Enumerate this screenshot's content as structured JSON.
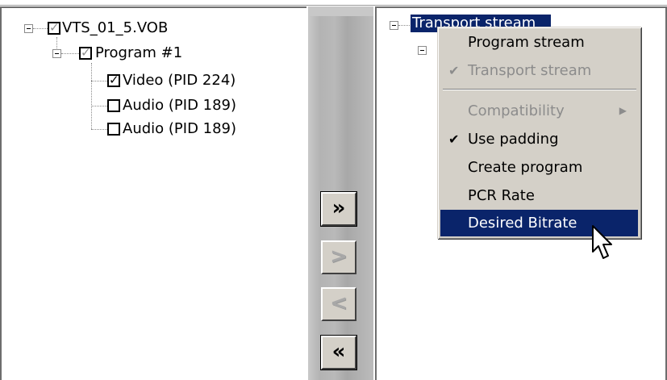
{
  "left_tree": {
    "root_label": "VTS_01_5.VOB",
    "program_label": "Program #1",
    "streams": [
      {
        "label": "Video (PID 224)",
        "checked": true
      },
      {
        "label": "Audio (PID 189)",
        "checked": false
      },
      {
        "label": "Audio (PID 189)",
        "checked": false
      }
    ]
  },
  "buttons": {
    "add_all": "»",
    "add_one": ">",
    "remove_one": "<",
    "remove_all": "«"
  },
  "right_tree": {
    "root_label": "Transport stream"
  },
  "context_menu": {
    "items": [
      {
        "label": "Program stream",
        "disabled": false,
        "checked": false
      },
      {
        "label": "Transport stream",
        "disabled": true,
        "checked": true
      },
      {
        "label": "Compatibility",
        "disabled": true,
        "checked": false,
        "submenu": true
      },
      {
        "label": "Use padding",
        "disabled": false,
        "checked": true
      },
      {
        "label": "Create program",
        "disabled": false,
        "checked": false
      },
      {
        "label": "PCR Rate",
        "disabled": false,
        "checked": false
      },
      {
        "label": "Desired Bitrate",
        "disabled": false,
        "checked": false,
        "selected": true
      }
    ]
  },
  "icons": {
    "check": "check-icon",
    "submenu": "submenu-arrow-icon",
    "cursor": "mouse-cursor-icon",
    "expander": "collapse-icon"
  },
  "colors": {
    "selection": "#0a246a",
    "menu_bg": "#d4d0c8",
    "disabled_text": "#8c8c8c"
  }
}
